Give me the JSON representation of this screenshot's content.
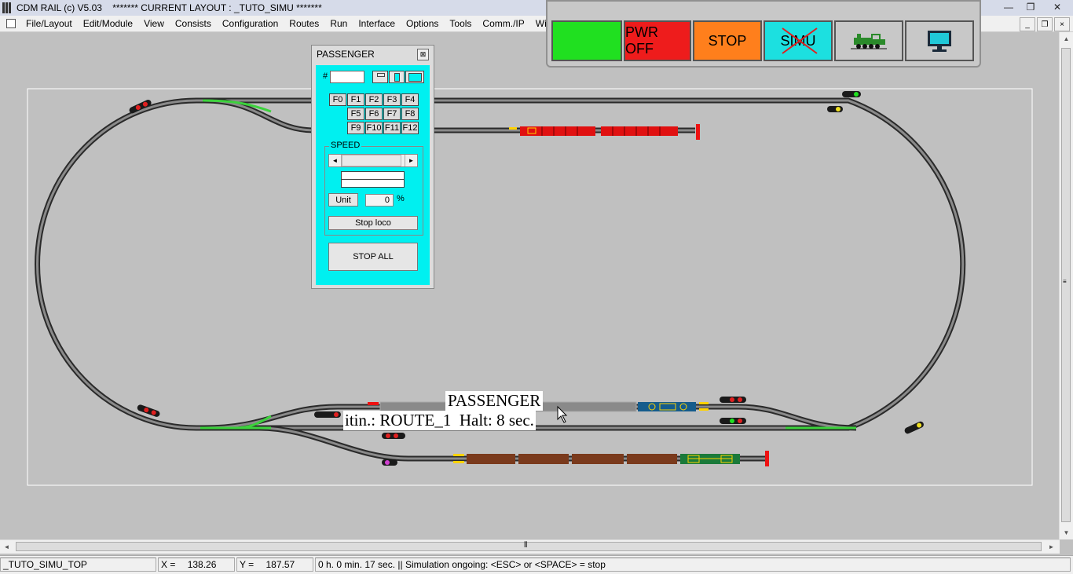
{
  "window": {
    "title": "CDM RAIL (c) V5.03    ******* CURRENT LAYOUT : _TUTO_SIMU *******",
    "min_glyph": "—",
    "max_glyph": "❐",
    "close_glyph": "✕"
  },
  "menu": {
    "items": [
      "File/Layout",
      "Edit/Module",
      "View",
      "Consists",
      "Configuration",
      "Routes",
      "Run",
      "Interface",
      "Options",
      "Tools",
      "Comm./IP",
      "Wi"
    ]
  },
  "mdi": {
    "min": "_",
    "restore": "❐",
    "close": "×"
  },
  "control_panel": {
    "power_on_color": "#20e020",
    "pwr_off_label": "PWR OFF",
    "pwr_off_color": "#ee1c1c",
    "stop_label": "STOP",
    "stop_color": "#ff7f1c",
    "simu_label": "SIMU",
    "simu_color": "#1ce0e0",
    "loco_icon": "steam-locomotive-icon",
    "monitor_icon": "monitor-icon"
  },
  "loco_window": {
    "title": "PASSENGER",
    "close_glyph": "⊠",
    "address_prefix": "#",
    "address_value": "",
    "function_keys": [
      "F0",
      "F1",
      "F2",
      "F3",
      "F4",
      "F5",
      "F6",
      "F7",
      "F8",
      "F9",
      "F10",
      "F11",
      "F12"
    ],
    "speed_label": "SPEED",
    "slider_left": "◄",
    "slider_right": "►",
    "speed_fraction": 0.0,
    "unit_label": "Unit",
    "speed_value": "0",
    "percent": "%",
    "stop_loco_label": "Stop loco",
    "stop_all_label": "STOP ALL",
    "body_color": "#00f0f0"
  },
  "train_tooltip": {
    "name": "PASSENGER",
    "itinerary": "itin.: ROUTE_1  Halt: 8 sec."
  },
  "status": {
    "layout": "_TUTO_SIMU_TOP",
    "x_label": "X =",
    "x_value": "138.26",
    "y_label": "Y =",
    "y_value": "187.57",
    "message": "0 h. 0 min. 17 sec.  || Simulation ongoing: <ESC> or <SPACE> = stop"
  },
  "scroll": {
    "up": "▲",
    "down": "▼",
    "left": "◄",
    "right": "►",
    "grip": "⦀"
  }
}
